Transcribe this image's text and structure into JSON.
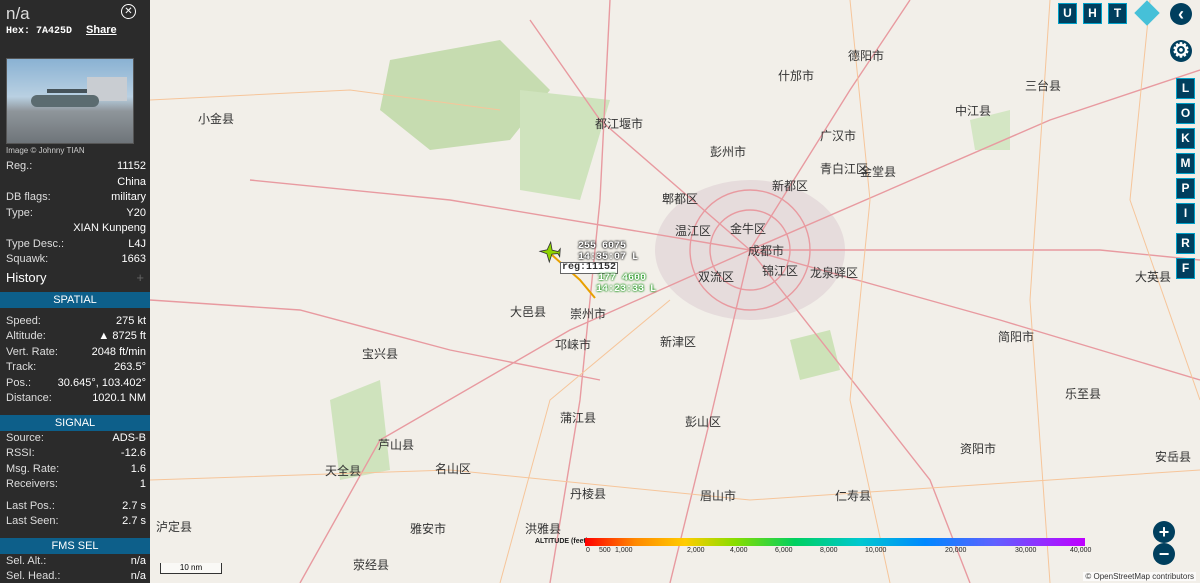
{
  "aircraft": {
    "callsign": "n/a",
    "hex_label": "Hex: 7A425D",
    "share": "Share",
    "photo_credit": "Image © Johnny TIAN",
    "reg_label": "Reg.:",
    "reg": "11152",
    "country": "China",
    "dbflags_label": "DB flags:",
    "dbflags": "military",
    "type_label": "Type:",
    "type": "Y20",
    "model": "XIAN Kunpeng",
    "typedesc_label": "Type Desc.:",
    "typedesc": "L4J",
    "squawk_label": "Squawk:",
    "squawk": "1663"
  },
  "history_label": "History",
  "spatial": {
    "title": "SPATIAL",
    "speed_label": "Speed:",
    "speed": "275 kt",
    "alt_label": "Altitude:",
    "alt": "▲ 8725 ft",
    "vrate_label": "Vert. Rate:",
    "vrate": "2048 ft/min",
    "track_label": "Track:",
    "track": "263.5°",
    "pos_label": "Pos.:",
    "pos": "30.645°, 103.402°",
    "dist_label": "Distance:",
    "dist": "1020.1 NM"
  },
  "signal": {
    "title": "SIGNAL",
    "source_label": "Source:",
    "source": "ADS-B",
    "rssi_label": "RSSI:",
    "rssi": "-12.6",
    "msgrate_label": "Msg. Rate:",
    "msgrate": "1.6",
    "receivers_label": "Receivers:",
    "receivers": "1",
    "lastpos_label": "Last Pos.:",
    "lastpos": "2.7 s",
    "lastseen_label": "Last Seen:",
    "lastseen": "2.7 s"
  },
  "fms": {
    "title": "FMS SEL",
    "selalt_label": "Sel. Alt.:",
    "selalt": "n/a",
    "selhead_label": "Sel. Head.:",
    "selhead": "n/a"
  },
  "controls": {
    "u": "U",
    "h": "H",
    "t": "T",
    "l": "L",
    "o": "O",
    "k": "K",
    "m": "M",
    "p": "P",
    "i": "I",
    "r": "R",
    "f": "F",
    "plus": "+",
    "minus": "−"
  },
  "track_labels": {
    "a1": "255  6075",
    "a2": "14:35:07 L",
    "reg_tag": "reg:11152",
    "b1": "177  4600",
    "b2": "14:23:33 L"
  },
  "legend": {
    "title": "ALTITUDE (feet)",
    "ticks": [
      "0",
      "500",
      "1,000",
      "2,000",
      "4,000",
      "6,000",
      "8,000",
      "10,000",
      "20,000",
      "30,000",
      "40,000"
    ]
  },
  "scale": "10 nm",
  "attribution": "© OpenStreetMap contributors",
  "places": [
    "都江堰市",
    "彭州市",
    "什邡市",
    "德阳市",
    "广汉市",
    "中江县",
    "三台县",
    "成都市",
    "金牛区",
    "锦江区",
    "新都区",
    "青白江区",
    "金堂县",
    "双流区",
    "温江区",
    "郫都区",
    "龙泉驿区",
    "邛崃市",
    "新津区",
    "眉山市",
    "彭山区",
    "蒲江县",
    "丹棱县",
    "洪雅县",
    "雅安市",
    "名山区",
    "芦山县",
    "天全县",
    "荥经县",
    "宝兴县",
    "泸定县",
    "小金县",
    "简阳市",
    "资阳市",
    "仁寿县",
    "乐至县",
    "安岳县",
    "大英县",
    "崇州市",
    "大邑县"
  ]
}
